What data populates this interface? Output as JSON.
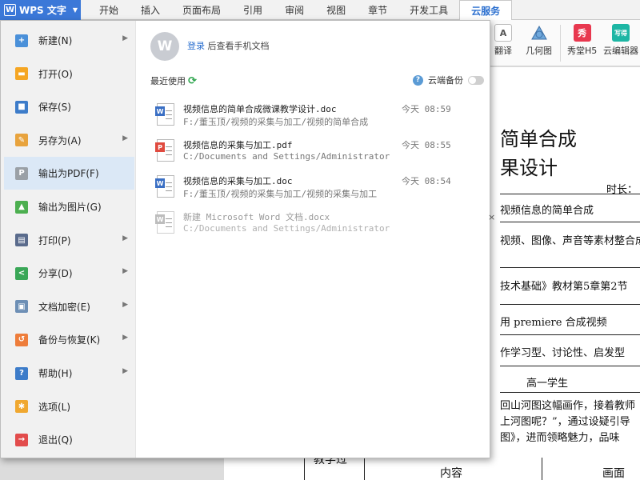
{
  "app": {
    "logo_glyph": "W",
    "title": "WPS 文字"
  },
  "tabs": [
    {
      "label": "开始"
    },
    {
      "label": "插入"
    },
    {
      "label": "页面布局"
    },
    {
      "label": "引用"
    },
    {
      "label": "审阅"
    },
    {
      "label": "视图"
    },
    {
      "label": "章节"
    },
    {
      "label": "开发工具"
    },
    {
      "label": "云服务"
    }
  ],
  "active_tab": "云服务",
  "ribbon": {
    "translate_label": "翻译",
    "geometry_label": "几何图",
    "xiu_label": "秀堂H5",
    "xiu_icon_text": "秀",
    "cloud_editor_label": "云编辑器",
    "cloud_editor_icon_text": "写得"
  },
  "menu": {
    "items": [
      {
        "label": "新建(N)",
        "icon": "new-doc-icon",
        "color": "#4a90d9",
        "submenu": true
      },
      {
        "label": "打开(O)",
        "icon": "folder-icon",
        "color": "#f5a623",
        "submenu": false
      },
      {
        "label": "保存(S)",
        "icon": "save-icon",
        "color": "#3d7cc9",
        "submenu": false
      },
      {
        "label": "另存为(A)",
        "icon": "save-as-icon",
        "color": "#e8a33d",
        "submenu": true
      },
      {
        "label": "输出为PDF(F)",
        "icon": "pdf-export-icon",
        "color": "#9aa0a6",
        "submenu": false
      },
      {
        "label": "输出为图片(G)",
        "icon": "image-export-icon",
        "color": "#4caf50",
        "submenu": false
      },
      {
        "label": "打印(P)",
        "icon": "printer-icon",
        "color": "#5a6b8c",
        "submenu": true
      },
      {
        "label": "分享(D)",
        "icon": "share-icon",
        "color": "#3aa757",
        "submenu": true
      },
      {
        "label": "文档加密(E)",
        "icon": "lock-icon",
        "color": "#6d8fb5",
        "submenu": true
      },
      {
        "label": "备份与恢复(K)",
        "icon": "backup-icon",
        "color": "#ee7d3b",
        "submenu": true
      },
      {
        "label": "帮助(H)",
        "icon": "help-icon",
        "color": "#3d7cc9",
        "submenu": true
      },
      {
        "label": "选项(L)",
        "icon": "gear-icon",
        "color": "#f0a830",
        "submenu": false
      },
      {
        "label": "退出(Q)",
        "icon": "exit-icon",
        "color": "#e24c4c",
        "submenu": false
      }
    ],
    "active_item": "输出为PDF(F)"
  },
  "account": {
    "avatar_glyph": "W",
    "login_link": "登录",
    "login_hint": "后查看手机文档"
  },
  "recent": {
    "label": "最近使用",
    "cloud_backup_label": "云端备份",
    "cloud_backup_on": false,
    "files": [
      {
        "name": "视频信息的简单合成微课教学设计.doc",
        "path": "F:/董玉顶/视频的采集与加工/视频的简单合成",
        "time": "今天 08:59",
        "type": "doc",
        "dim": false
      },
      {
        "name": "视频信息的采集与加工.pdf",
        "path": "C:/Documents and Settings/Administrator",
        "time": "今天 08:55",
        "type": "pdf",
        "dim": false
      },
      {
        "name": "视频信息的采集与加工.doc",
        "path": "F:/董玉顶/视频的采集与加工/视频的采集与加工",
        "time": "今天 08:54",
        "type": "doc",
        "dim": false
      },
      {
        "name": "新建 Microsoft Word 文档.docx",
        "path": "C:/Documents and Settings/Administrator",
        "time": "",
        "type": "doc",
        "dim": true
      }
    ],
    "close_glyph": "×"
  },
  "document": {
    "title_line1": "简单合成",
    "title_line2": "果设计",
    "duration_label": "时长：",
    "rows": [
      "视频信息的简单合成",
      "视频、图像、声音等素材整合成",
      "技术基础》教材第5章第2节",
      "用 premiere 合成视频",
      "作学习型、讨论性、启发型",
      "高一学生",
      "回山河图这幅画作，接着教师",
      "上河图呢？”，通过设疑引导",
      "图》，进而领略魅力，品味"
    ],
    "bottom_cells": [
      "教学过",
      "内容",
      "画面"
    ]
  }
}
